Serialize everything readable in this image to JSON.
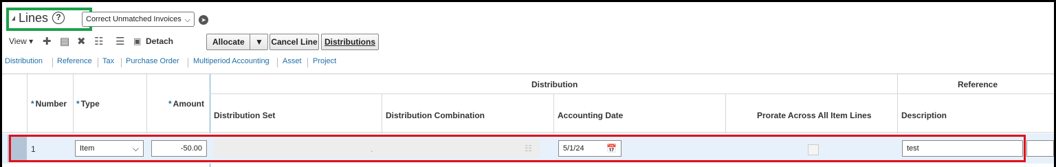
{
  "header": {
    "title": "Lines",
    "help_glyph": "?",
    "action_select": "Correct Unmatched Invoices"
  },
  "toolbar": {
    "view_label": "View",
    "detach_label": "Detach",
    "allocate_label": "Allocate",
    "cancel_line_label": "Cancel Line",
    "distributions_label": "Distributions"
  },
  "tabs": [
    "Distribution",
    "Reference",
    "Tax",
    "Purchase Order",
    "Multiperiod Accounting",
    "Asset",
    "Project"
  ],
  "table": {
    "group_headers": {
      "distribution": "Distribution",
      "reference": "Reference"
    },
    "columns": {
      "number": "Number",
      "type": "Type",
      "amount": "Amount",
      "distribution_set": "Distribution Set",
      "distribution_combination": "Distribution Combination",
      "accounting_date": "Accounting Date",
      "prorate": "Prorate Across All Item Lines",
      "description": "Description"
    },
    "required_marker": "*",
    "rows": [
      {
        "number": "1",
        "type": "Item",
        "amount": "-50.00",
        "distribution_combination": ".",
        "accounting_date": "5/1/24",
        "description": "test"
      }
    ]
  },
  "colors": {
    "highlight_green": "#1aa24a",
    "highlight_red": "#e0101a",
    "link_blue": "#1e6fa8"
  }
}
